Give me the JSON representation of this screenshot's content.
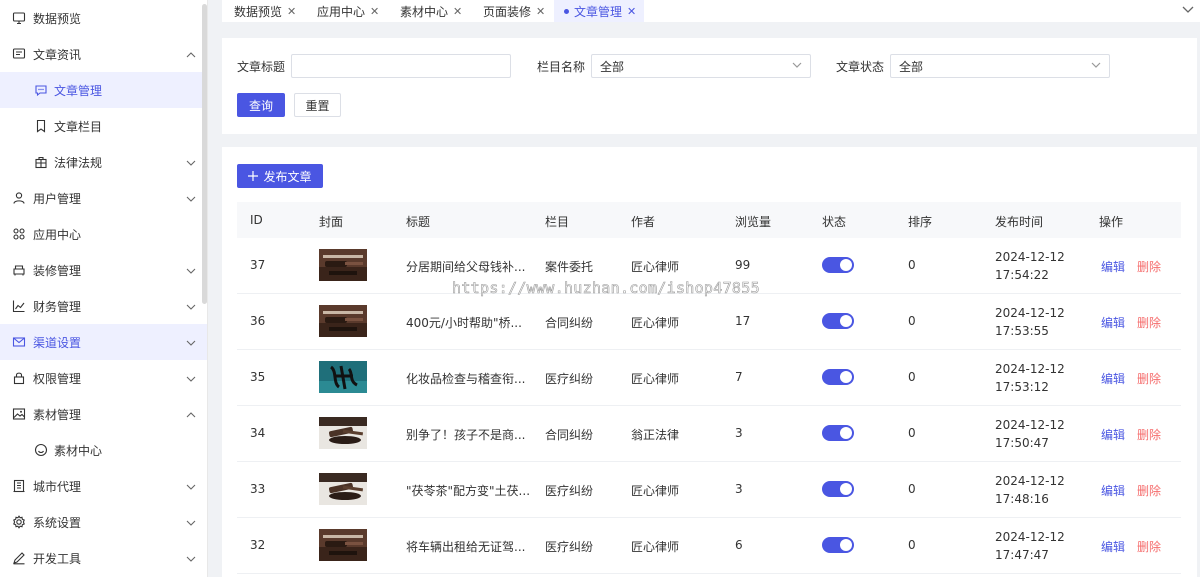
{
  "sidebar": {
    "items": [
      {
        "label": "数据预览",
        "icon": "monitor-icon",
        "arrow": ""
      },
      {
        "label": "文章资讯",
        "icon": "message-icon",
        "arrow": "up"
      },
      {
        "label": "文章管理",
        "icon": "chat-icon",
        "arrow": "",
        "sub": true,
        "active": true
      },
      {
        "label": "文章栏目",
        "icon": "bookmark-icon",
        "arrow": "",
        "sub": true
      },
      {
        "label": "法律法规",
        "icon": "bag-icon",
        "arrow": "down",
        "sub": true
      },
      {
        "label": "用户管理",
        "icon": "user-icon",
        "arrow": "down"
      },
      {
        "label": "应用中心",
        "icon": "grid-icon",
        "arrow": ""
      },
      {
        "label": "装修管理",
        "icon": "sofa-icon",
        "arrow": "down"
      },
      {
        "label": "财务管理",
        "icon": "chart-icon",
        "arrow": "down"
      },
      {
        "label": "渠道设置",
        "icon": "mail-icon",
        "arrow": "down",
        "highlight": true
      },
      {
        "label": "权限管理",
        "icon": "lock-icon",
        "arrow": "down"
      },
      {
        "label": "素材管理",
        "icon": "image-icon",
        "arrow": "up"
      },
      {
        "label": "素材中心",
        "icon": "smile-icon",
        "arrow": "",
        "sub": true
      },
      {
        "label": "城市代理",
        "icon": "building-icon",
        "arrow": "down"
      },
      {
        "label": "系统设置",
        "icon": "gear-icon",
        "arrow": "down"
      },
      {
        "label": "开发工具",
        "icon": "pen-icon",
        "arrow": "down"
      }
    ]
  },
  "tabs": [
    {
      "label": "数据预览"
    },
    {
      "label": "应用中心"
    },
    {
      "label": "素材中心"
    },
    {
      "label": "页面装修"
    },
    {
      "label": "文章管理",
      "active": true
    }
  ],
  "filters": {
    "title_label": "文章标题",
    "title_value": "",
    "column_label": "栏目名称",
    "column_value": "全部",
    "status_label": "文章状态",
    "status_value": "全部",
    "query_button": "查询",
    "reset_button": "重置"
  },
  "table": {
    "publish_button": "发布文章",
    "publish_icon": "plus-icon",
    "columns": [
      "ID",
      "封面",
      "标题",
      "栏目",
      "作者",
      "浏览量",
      "状态",
      "排序",
      "发布时间",
      "操作"
    ],
    "edit_label": "编辑",
    "delete_label": "删除",
    "rows": [
      {
        "id": "37",
        "title": "分居期间给父母钱补...",
        "column": "案件委托",
        "author": "匠心律师",
        "views": "99",
        "status_on": true,
        "sort": "0",
        "time": "2024-12-12 17:54:22",
        "cover": "gavel"
      },
      {
        "id": "36",
        "title": "400元/小时帮助\"桥...",
        "column": "合同纠纷",
        "author": "匠心律师",
        "views": "17",
        "status_on": true,
        "sort": "0",
        "time": "2024-12-12 17:53:55",
        "cover": "gavel"
      },
      {
        "id": "35",
        "title": "化妆品检查与稽查衔...",
        "column": "医疗纠纷",
        "author": "匠心律师",
        "views": "7",
        "status_on": true,
        "sort": "0",
        "time": "2024-12-12 17:53:12",
        "cover": "calligraphy"
      },
      {
        "id": "34",
        "title": "别争了！孩子不是商...",
        "column": "合同纠纷",
        "author": "翁正法律",
        "views": "3",
        "status_on": true,
        "sort": "0",
        "time": "2024-12-12 17:50:47",
        "cover": "gavel-white"
      },
      {
        "id": "33",
        "title": "\"茯苓茶\"配方变\"土茯...",
        "column": "医疗纠纷",
        "author": "匠心律师",
        "views": "3",
        "status_on": true,
        "sort": "0",
        "time": "2024-12-12 17:48:16",
        "cover": "gavel-white"
      },
      {
        "id": "32",
        "title": "将车辆出租给无证驾...",
        "column": "医疗纠纷",
        "author": "匠心律师",
        "views": "6",
        "status_on": true,
        "sort": "0",
        "time": "2024-12-12 17:47:47",
        "cover": "gavel"
      }
    ]
  },
  "watermark": "https://www.huzhan.com/ishop47855",
  "colors": {
    "accent": "#4a56e2",
    "danger": "#f56c6c"
  }
}
